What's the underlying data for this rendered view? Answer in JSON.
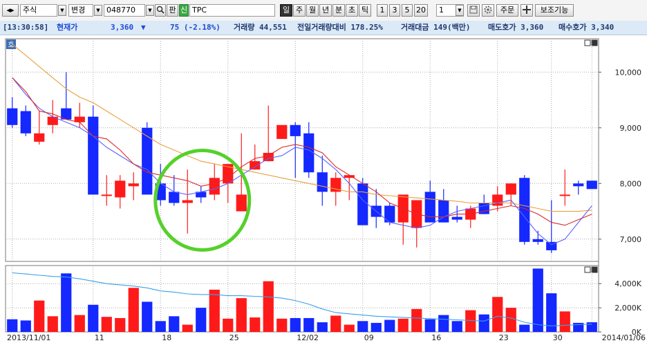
{
  "toolbar": {
    "nav_arrows": "◂▸",
    "market": "주식",
    "change_label": "변경",
    "code": "048770",
    "search_icon": "magnifier-icon",
    "pan_label": "판",
    "new_badge": "신",
    "stock_name": "TPC",
    "periods": [
      "일",
      "주",
      "월",
      "년",
      "분",
      "초",
      "틱"
    ],
    "active_period": "일",
    "intervals": [
      "1",
      "3",
      "5",
      "20"
    ],
    "interval_value": "1",
    "save_icon": "save-icon",
    "settings_icon": "gear-icon",
    "order_label": "주문",
    "crosshair_icon": "crosshair-icon",
    "aux_label": "보조기능"
  },
  "info": {
    "time": "[13:30:58]",
    "price_label": "현재가",
    "price": "3,360",
    "direction": "▼",
    "change": "75 (-2.18%)",
    "volume": "거래량 44,551",
    "prev_volume_ratio": "전일거래량대비 178.25%",
    "amount": "거래대금 149(백만)",
    "ask": "매도호가 3,360",
    "bid": "매수호가 3,340"
  },
  "panel_badge": "호",
  "chart_data": [
    {
      "type": "candlestick",
      "x": [
        "2013/11/01",
        "11/04",
        "11/05",
        "11/06",
        "11/07",
        "11/08",
        "11/11",
        "11/12",
        "11/13",
        "11/14",
        "11/15",
        "11/18",
        "11/19",
        "11/20",
        "11/21",
        "11/22",
        "11/25",
        "11/26",
        "11/27",
        "11/28",
        "11/29",
        "12/02",
        "12/03",
        "12/04",
        "12/05",
        "12/06",
        "12/09",
        "12/10",
        "12/11",
        "12/12",
        "12/13",
        "12/16",
        "12/17",
        "12/18",
        "12/19",
        "12/20",
        "12/23",
        "12/24",
        "12/26",
        "12/27",
        "12/30",
        "2014/01/02",
        "01/03",
        "01/06"
      ],
      "open": [
        9350,
        9300,
        8750,
        9050,
        9350,
        9100,
        9200,
        7800,
        7750,
        7950,
        9000,
        8000,
        7850,
        7650,
        7850,
        7800,
        8000,
        7500,
        8250,
        8400,
        8800,
        9050,
        8900,
        8200,
        7850,
        8100,
        8000,
        7600,
        7600,
        7300,
        7200,
        7850,
        7700,
        7400,
        7350,
        7650,
        7600,
        7800,
        8100,
        7000,
        6950,
        7800,
        8000,
        8050
      ],
      "high": [
        9550,
        9400,
        9300,
        9500,
        10000,
        9450,
        9400,
        8150,
        8150,
        8200,
        9100,
        8350,
        8150,
        8250,
        7950,
        8350,
        8300,
        8900,
        8700,
        9400,
        9000,
        9100,
        9100,
        8500,
        8200,
        8150,
        8100,
        7900,
        7650,
        7350,
        7700,
        8050,
        7900,
        7600,
        7600,
        7800,
        7950,
        8000,
        8150,
        7150,
        7700,
        8250,
        8050,
        8000
      ],
      "low": [
        9000,
        8850,
        8700,
        8900,
        9200,
        9000,
        8800,
        7600,
        7550,
        7700,
        7800,
        7600,
        7600,
        7100,
        7650,
        7700,
        7650,
        7500,
        8250,
        8400,
        8800,
        8100,
        8100,
        7600,
        7600,
        7700,
        7500,
        7200,
        7250,
        6900,
        6850,
        7450,
        7300,
        7300,
        7200,
        7450,
        7500,
        7600,
        6900,
        6900,
        6750,
        7600,
        7800,
        7900
      ],
      "close": [
        9050,
        8900,
        8900,
        9200,
        9150,
        9200,
        7800,
        7800,
        8050,
        8000,
        7800,
        7700,
        7650,
        7700,
        7750,
        8100,
        8350,
        7800,
        8400,
        8550,
        9050,
        8850,
        8200,
        7850,
        8100,
        8150,
        7250,
        7400,
        7300,
        7800,
        7700,
        7300,
        7300,
        7350,
        7550,
        7450,
        7800,
        8000,
        6950,
        6950,
        6800,
        7800,
        7950,
        7900
      ],
      "ma_short": [
        9900,
        9650,
        9300,
        9250,
        9150,
        9100,
        8850,
        8800,
        8600,
        8350,
        8200,
        8150,
        8100,
        8050,
        7950,
        8000,
        8100,
        8300,
        8450,
        8500,
        8650,
        8700,
        8650,
        8550,
        8300,
        8150,
        8000,
        7850,
        7650,
        7550,
        7450,
        7400,
        7400,
        7450,
        7450,
        7500,
        7550,
        7600,
        7550,
        7450,
        7300,
        7250,
        7350,
        7450
      ],
      "ma_mid": [
        9900,
        9600,
        9350,
        9200,
        9100,
        9000,
        8850,
        8650,
        8500,
        8350,
        8250,
        8000,
        7850,
        7800,
        7850,
        7900,
        8000,
        8150,
        8300,
        8450,
        8500,
        8650,
        8600,
        8450,
        8250,
        8000,
        7700,
        7500,
        7300,
        7250,
        7200,
        7250,
        7400,
        7500,
        7550,
        7600,
        7650,
        7700,
        7400,
        7100,
        6900,
        7000,
        7300,
        7600
      ],
      "ma_long": [
        10500,
        10300,
        10100,
        9900,
        9700,
        9550,
        9450,
        9300,
        9150,
        9000,
        8850,
        8700,
        8600,
        8500,
        8400,
        8350,
        8300,
        8250,
        8200,
        8150,
        8100,
        8050,
        8000,
        7950,
        7900,
        7850,
        7850,
        7800,
        7780,
        7760,
        7740,
        7720,
        7700,
        7680,
        7650,
        7650,
        7650,
        7650,
        7600,
        7550,
        7500,
        7500,
        7500,
        7520
      ],
      "y_ticks": [
        "10,000",
        "9,000",
        "8,000",
        "7,000"
      ],
      "ylim": [
        6600,
        10600
      ],
      "x_tick_labels": [
        "2013/11/01",
        "11",
        "18",
        "25",
        "12/02",
        "09",
        "16",
        "23",
        "30",
        "2014/01/06"
      ],
      "annotation": "green-circle"
    },
    {
      "type": "bar",
      "name": "volume",
      "values": [
        1050,
        950,
        2600,
        1300,
        4850,
        1400,
        2250,
        1250,
        1150,
        3650,
        2500,
        900,
        1300,
        600,
        2000,
        3500,
        1100,
        2800,
        1200,
        4200,
        1100,
        1150,
        1150,
        800,
        1350,
        600,
        900,
        750,
        1000,
        1100,
        1900,
        1050,
        1400,
        900,
        1800,
        1450,
        2900,
        2000,
        600,
        5250,
        3200,
        1700,
        750,
        800
      ],
      "line": [
        4900,
        4800,
        4700,
        4600,
        4550,
        4400,
        4200,
        4000,
        3900,
        3800,
        3650,
        3400,
        3300,
        3150,
        3100,
        3100,
        3000,
        3000,
        2950,
        2900,
        2800,
        2600,
        2300,
        1900,
        1600,
        1500,
        1400,
        1300,
        1250,
        1200,
        1150,
        1100,
        1050,
        1000,
        950,
        900,
        1300,
        1150,
        800,
        600,
        500,
        550,
        600,
        650
      ],
      "y_ticks": [
        "4,000K",
        "2,000K",
        "0K"
      ],
      "ylim": [
        0,
        5500
      ]
    }
  ]
}
